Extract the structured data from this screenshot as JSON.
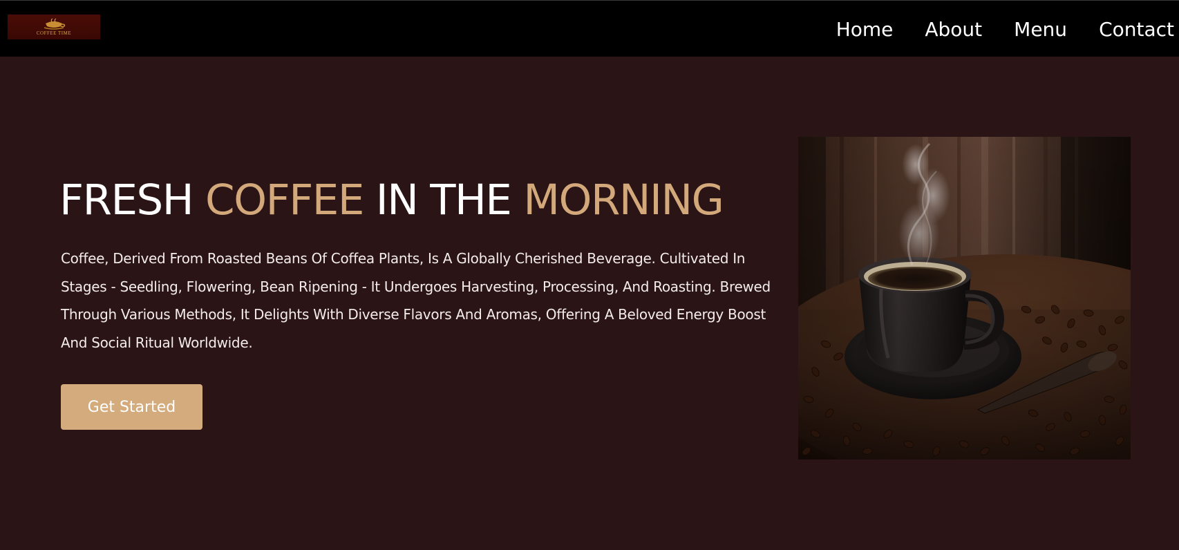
{
  "header": {
    "logo_text": "COFFEE TIME",
    "nav": [
      {
        "label": "Home"
      },
      {
        "label": "About"
      },
      {
        "label": "Menu"
      },
      {
        "label": "Contact"
      }
    ]
  },
  "hero": {
    "title": {
      "part1": "FRESH ",
      "accent1": "COFFEE",
      "part2": " IN THE ",
      "accent2": "MORNING"
    },
    "description": "Coffee, Derived From Roasted Beans Of Coffea Plants, Is A Globally Cherished Beverage. Cultivated In Stages - Seedling, Flowering, Bean Ripening - It Undergoes Harvesting, Processing, And Roasting. Brewed Through Various Methods, It Delights With Diverse Flavors And Aromas, Offering A Beloved Energy Boost And Social Ritual Worldwide.",
    "cta_label": "Get Started",
    "image_icon": "coffee-cup-photo"
  },
  "colors": {
    "background": "#2a1415",
    "navbar": "#000000",
    "accent": "#d3a97b",
    "button": "#d4ab7d",
    "text": "#ffffff"
  }
}
